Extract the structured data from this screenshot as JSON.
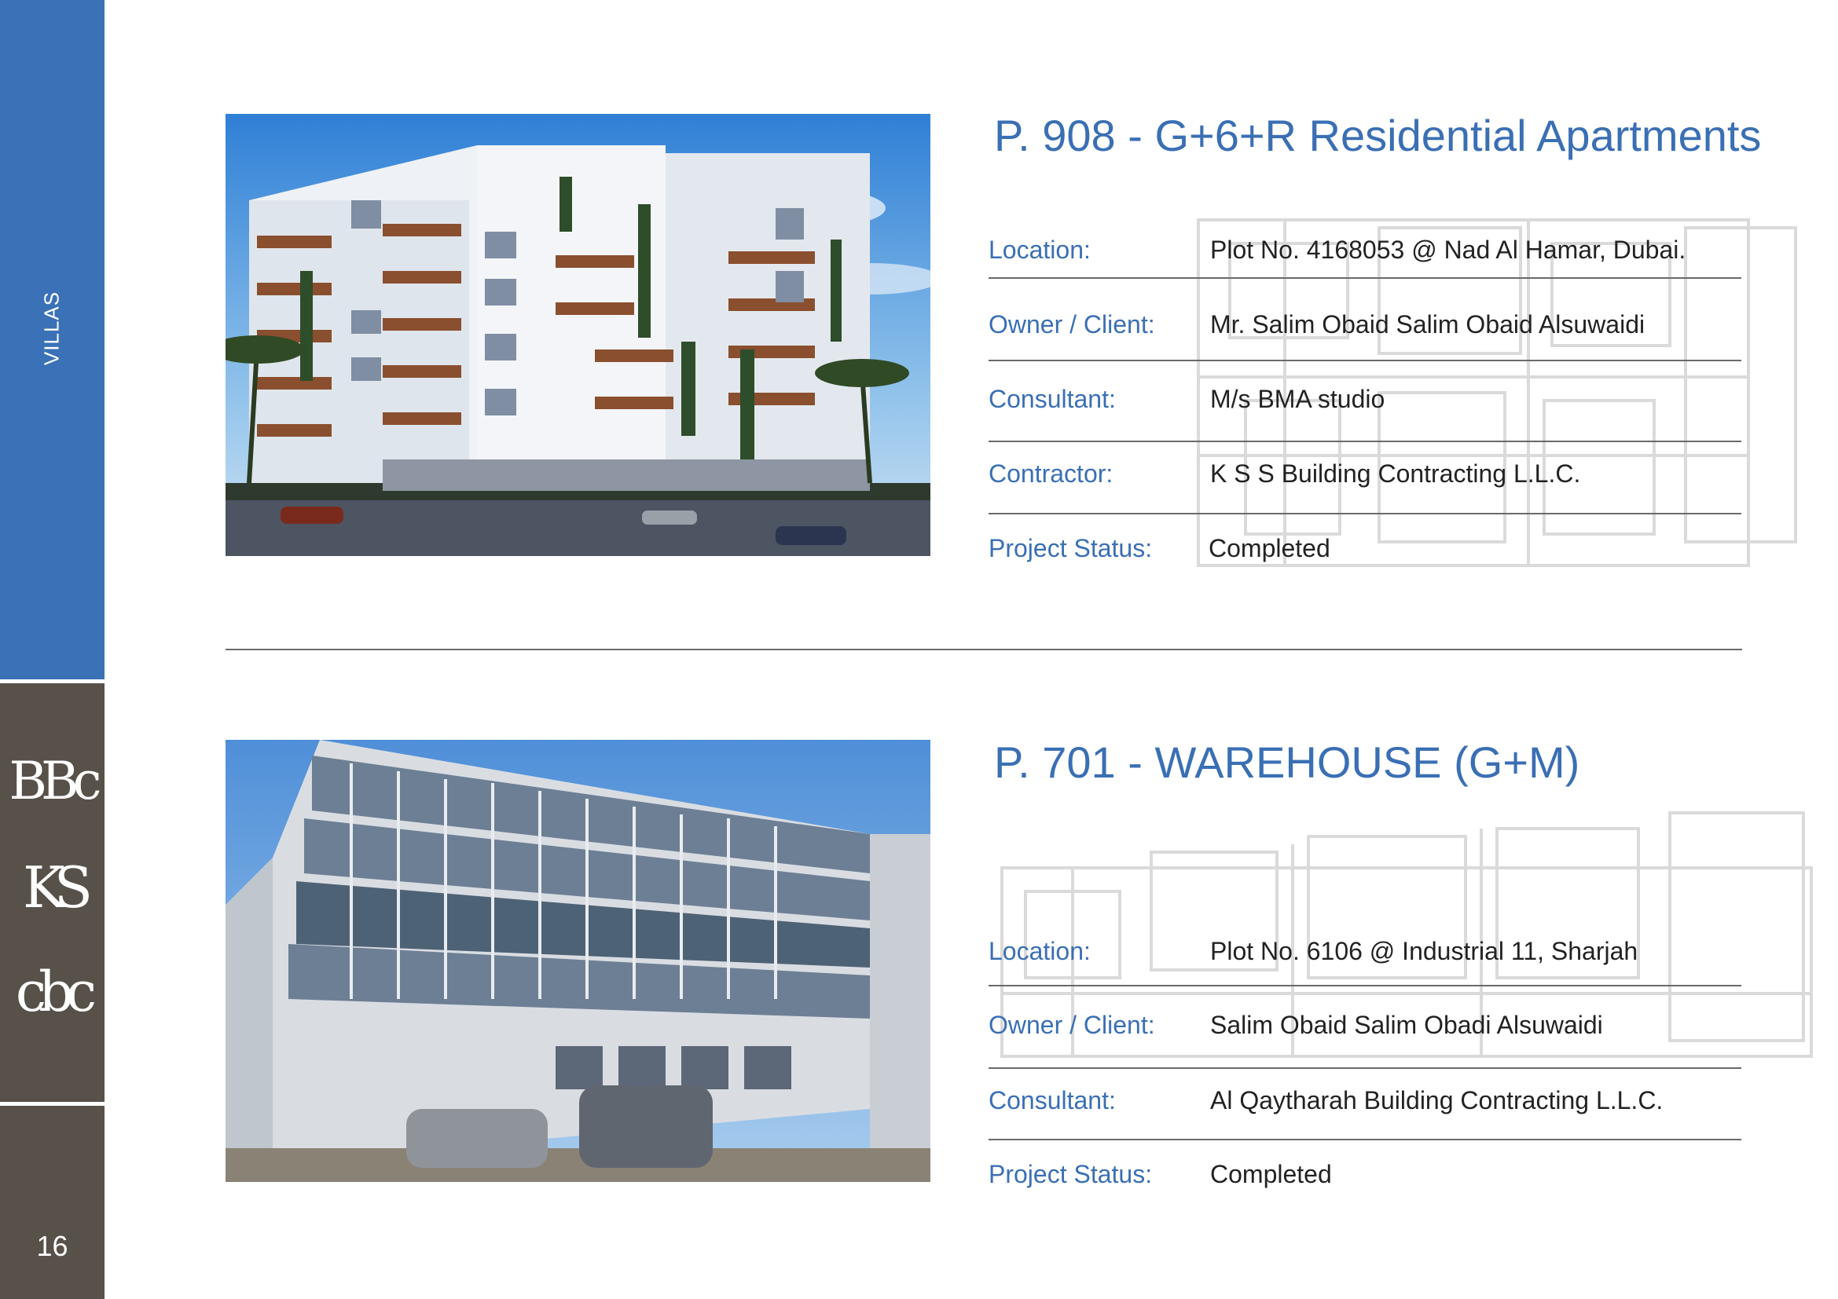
{
  "sidebar": {
    "section_label": "VILLAS",
    "logos": [
      "BBc",
      "KS",
      "cbc"
    ],
    "page_number": "16"
  },
  "colors": {
    "accent_blue": "#3a71b7",
    "brand_brown": "#585149",
    "title_blue": "#3a6fb4"
  },
  "projects": [
    {
      "title": "P. 908 - G+6+R Residential Apartments",
      "details": [
        {
          "label": "Location:",
          "value": "Plot No. 4168053 @ Nad Al Hamar, Dubai."
        },
        {
          "label": "Owner / Client:",
          "value": "Mr. Salim Obaid Salim Obaid Alsuwaidi"
        },
        {
          "label": "Consultant:",
          "value": "M/s BMA studio"
        },
        {
          "label": "Contractor:",
          "value": "K S S Building Contracting L.L.C."
        },
        {
          "label": "Project Status:",
          "value": "Completed"
        }
      ]
    },
    {
      "title": "P. 701 - WAREHOUSE (G+M)",
      "details": [
        {
          "label": "Location:",
          "value": "Plot No. 6106 @ Industrial 11, Sharjah"
        },
        {
          "label": "Owner / Client:",
          "value": "Salim Obaid Salim Obadi Alsuwaidi"
        },
        {
          "label": "Consultant:",
          "value": "Al Qaytharah Building Contracting L.L.C."
        },
        {
          "label": "Project Status:",
          "value": "Completed"
        }
      ]
    }
  ]
}
